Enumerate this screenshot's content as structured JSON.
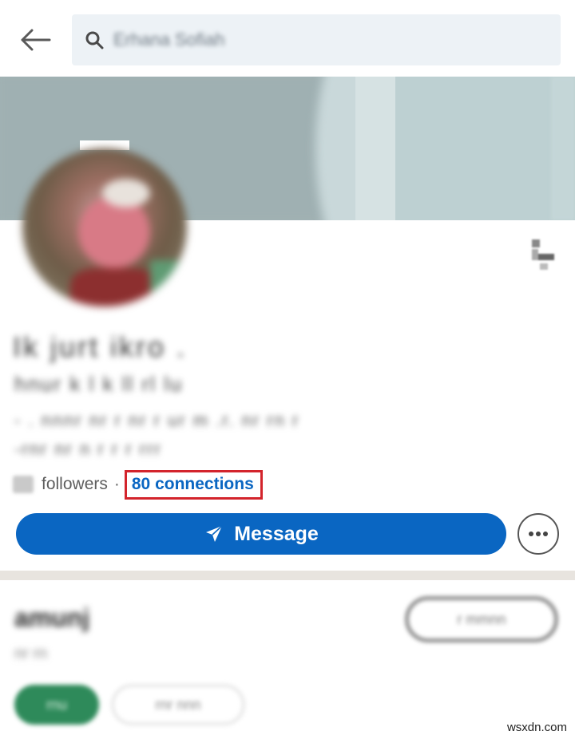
{
  "search": {
    "value": "Erhana Sofiah"
  },
  "profile": {
    "name": "Ik jurt ikro .",
    "headline": "hnur k l k ll rl lu",
    "about_line1": "- . nnnr nr r nr r ur m .r. nr rn r",
    "about_line2": "-rnr nr n r r r rrr"
  },
  "stats": {
    "followers_label": "followers",
    "separator": "·",
    "connections_label": "80 connections"
  },
  "actions": {
    "message_label": "Message"
  },
  "next_card": {
    "title": "amunj",
    "subtitle": "nr rn",
    "pill_label": "r mmnn",
    "green_label": "rnu",
    "outline_label": "rnr nnn"
  },
  "watermark": "wsxdn.com",
  "colors": {
    "accent": "#0a66c2",
    "highlight_box": "#d3242c",
    "search_bg": "#edf2f6",
    "divider": "#e8e4df"
  },
  "icons": {
    "back": "arrow-left-icon",
    "search": "search-icon",
    "send": "paper-plane-icon",
    "more": "ellipsis-icon"
  }
}
